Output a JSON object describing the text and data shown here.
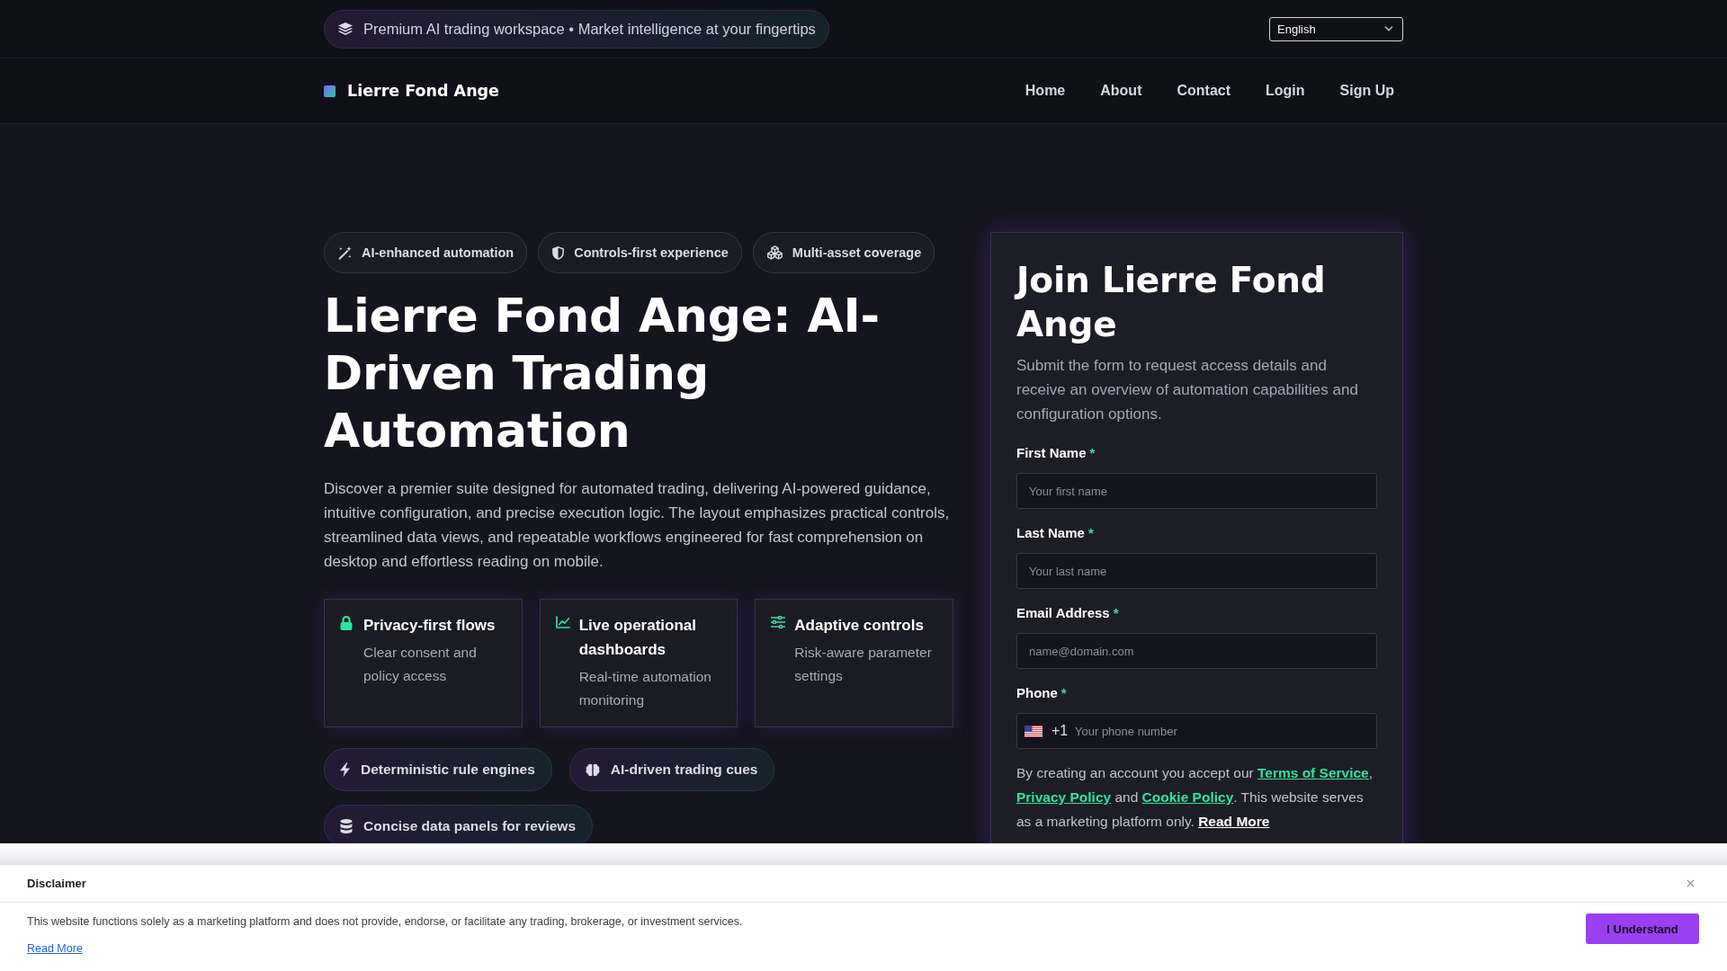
{
  "top_bar": {
    "announcement": "Premium AI trading workspace • Market intelligence at your fingertips",
    "language": "English"
  },
  "nav": {
    "brand": "Lierre Fond Ange",
    "links": [
      "Home",
      "About",
      "Contact",
      "Login",
      "Sign Up"
    ]
  },
  "hero": {
    "badges": [
      "AI-enhanced automation",
      "Controls-first experience",
      "Multi-asset coverage"
    ],
    "title": "Lierre Fond Ange: AI-Driven Trading Automation",
    "intro": "Discover a premier suite designed for automated trading, delivering AI-powered guidance, intuitive configuration, and precise execution logic. The layout emphasizes practical controls, streamlined data views, and repeatable workflows engineered for fast comprehension on desktop and effortless reading on mobile.",
    "features": [
      {
        "title": "Privacy-first flows",
        "text": "Clear consent and policy access"
      },
      {
        "title": "Live operational dashboards",
        "text": "Real-time automation monitoring"
      },
      {
        "title": "Adaptive controls",
        "text": "Risk-aware parameter settings"
      }
    ],
    "highlights": [
      "Deterministic rule engines",
      "AI-driven trading cues",
      "Concise data panels for reviews"
    ]
  },
  "signup": {
    "title": "Join Lierre Fond Ange",
    "intro": "Submit the form to request access details and receive an overview of automation capabilities and configuration options.",
    "fields": [
      {
        "kind": "text",
        "label": "First Name",
        "required_mark": "*",
        "placeholder": "Your first name"
      },
      {
        "kind": "text",
        "label": "Last Name",
        "required_mark": "*",
        "placeholder": "Your last name"
      },
      {
        "kind": "email",
        "label": "Email Address",
        "required_mark": "*",
        "placeholder": "name@domain.com"
      },
      {
        "kind": "phone",
        "label": "Phone",
        "required_mark": "*",
        "dial_code": "+1",
        "placeholder": "Your phone number"
      }
    ],
    "consent": [
      {
        "kind": "text",
        "text": "By creating an account you accept our "
      },
      {
        "kind": "policy",
        "text": "Terms of Service"
      },
      {
        "kind": "text",
        "text": ", "
      },
      {
        "kind": "policy",
        "text": "Privacy Policy"
      },
      {
        "kind": "text",
        "text": " and "
      },
      {
        "kind": "policy",
        "text": "Cookie Policy"
      },
      {
        "kind": "text",
        "text": ". This website serves as a marketing platform only. "
      },
      {
        "kind": "more",
        "text": "Read More"
      }
    ]
  },
  "disclaimer": {
    "title": "Disclaimer",
    "text": "This website functions solely as a marketing platform and does not provide, endorse, or facilitate any trading, brokerage, or investment services.",
    "link": "Read More",
    "button": "I Understand"
  }
}
